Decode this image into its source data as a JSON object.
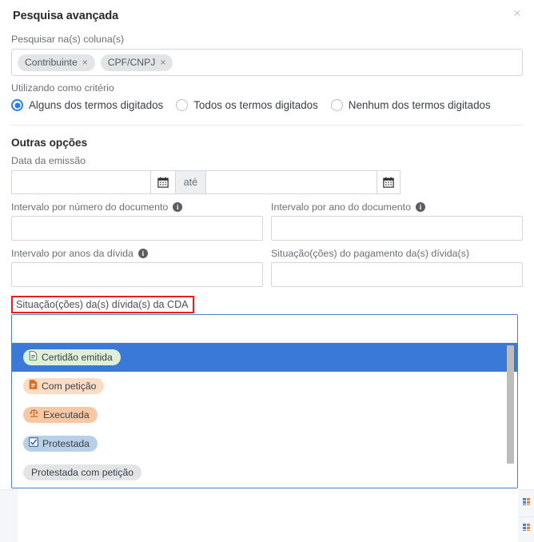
{
  "modal": {
    "title": "Pesquisa avançada",
    "close_label": "×"
  },
  "search_columns": {
    "label": "Pesquisar na(s) coluna(s)",
    "tokens": [
      {
        "label": "Contribuinte",
        "remove": "×"
      },
      {
        "label": "CPF/CNPJ",
        "remove": "×"
      }
    ]
  },
  "criteria": {
    "label": "Utilizando como critério",
    "options": [
      {
        "label": "Alguns dos termos digitados",
        "selected": true
      },
      {
        "label": "Todos os termos digitados",
        "selected": false
      },
      {
        "label": "Nenhum dos termos digitados",
        "selected": false
      }
    ],
    "accent_color": "#2b7de9"
  },
  "other_options": {
    "title": "Outras opções",
    "issue_date": {
      "label": "Data da emissão",
      "start_value": "",
      "start_placeholder": "",
      "until_label": "até",
      "end_value": "",
      "end_placeholder": "",
      "calendar_icon": "calendar-icon"
    },
    "fields": [
      {
        "label": "Intervalo por número do documento",
        "has_info": true,
        "value": "",
        "placeholder": ""
      },
      {
        "label": "Intervalo por ano do documento",
        "has_info": true,
        "value": "",
        "placeholder": ""
      },
      {
        "label": "Intervalo por anos da dívida",
        "has_info": true,
        "value": "",
        "placeholder": ""
      },
      {
        "label": "Situação(ções) do pagamento da(s) dívida(s)",
        "has_info": false,
        "value": "",
        "placeholder": ""
      }
    ]
  },
  "cda_select": {
    "label": "Situação(ções) da(s) dívida(s) da CDA",
    "highlight_color": "#ee1b1b",
    "input_value": "",
    "input_placeholder": "",
    "options": [
      {
        "label": "Certidão emitida",
        "icon": "document-icon",
        "glyph": "🗎",
        "bg": "#dff0d8",
        "icon_color": "#3d7a43",
        "active": true
      },
      {
        "label": "Com petição",
        "icon": "document-icon",
        "glyph": "🗎",
        "bg": "#fbdcc4",
        "icon_color": "#e06a1b",
        "active": false
      },
      {
        "label": "Executada",
        "icon": "scales-icon",
        "glyph": "⚖",
        "bg": "#f7c8a3",
        "icon_color": "#b4632a",
        "active": false
      },
      {
        "label": "Protestada",
        "icon": "checkbox-checked-icon",
        "glyph": "☑",
        "bg": "#b8cfe8",
        "icon_color": "#2a5a92",
        "active": false
      },
      {
        "label": "Protestada com petição",
        "icon": "",
        "glyph": "",
        "bg": "#e2e4e6",
        "icon_color": "",
        "active": false
      },
      {
        "label": "",
        "icon": "",
        "glyph": "",
        "bg": "#e2e4e6",
        "icon_color": "",
        "active": false
      }
    ],
    "active_bg": "#3b79d8",
    "scrollbar": "visible"
  }
}
